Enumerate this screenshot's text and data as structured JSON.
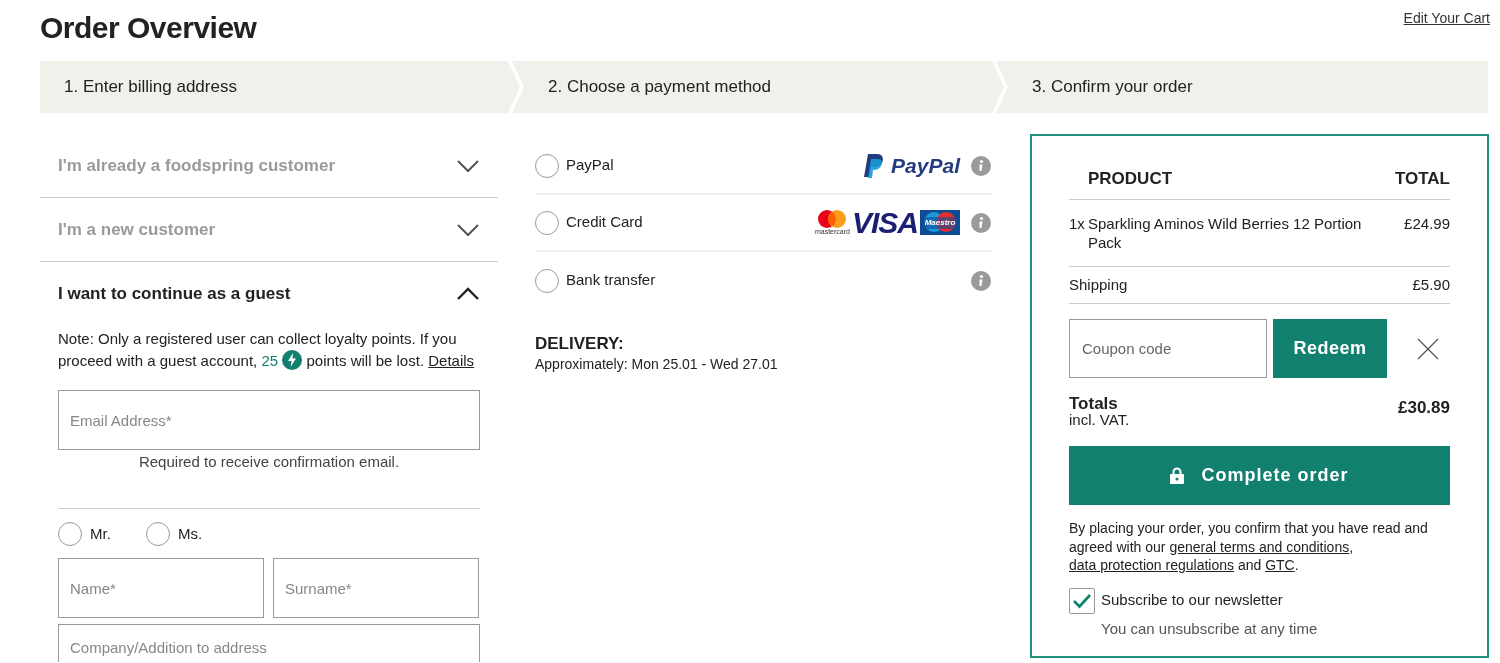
{
  "header": {
    "title": "Order Overview",
    "edit_link": "Edit Your Cart"
  },
  "steps": [
    {
      "label": "1. Enter billing address"
    },
    {
      "label": "2. Choose a payment method"
    },
    {
      "label": "3. Confirm your order"
    }
  ],
  "accordion": [
    {
      "title": "I'm already a foodspring customer",
      "expanded": false
    },
    {
      "title": "I'm a new customer",
      "expanded": false
    },
    {
      "title": "I want to continue as a guest",
      "expanded": true
    }
  ],
  "guest": {
    "note": {
      "before": "Note: Only a registered user can collect loyalty points. If you proceed with a guest account,",
      "points": "25",
      "after": "points will be lost.",
      "link": "Details"
    },
    "email": {
      "placeholder": "Email Address*",
      "hint": "Required to receive confirmation email."
    },
    "salutation": [
      {
        "label": "Mr.",
        "selected": false
      },
      {
        "label": "Ms.",
        "selected": false
      }
    ],
    "name": {
      "placeholder": "Name*"
    },
    "surname": {
      "placeholder": "Surname*"
    },
    "company": {
      "placeholder": "Company/Addition to address"
    }
  },
  "payment_methods": [
    {
      "label": "PayPal",
      "selected": false,
      "logos": [
        {
          "kind": "paypal",
          "text": "PayPal"
        }
      ]
    },
    {
      "label": "Credit Card",
      "selected": false,
      "logos": [
        {
          "kind": "mastercard",
          "text": "mastercard"
        },
        {
          "kind": "visa",
          "text": "VISA"
        },
        {
          "kind": "maestro",
          "text": "Maestro"
        }
      ]
    },
    {
      "label": "Bank transfer",
      "selected": false
    }
  ],
  "delivery": {
    "heading": "DELIVERY:",
    "text": "Approximately: Mon 25.01 - Wed 27.01"
  },
  "summary": {
    "columns": [
      "PRODUCT",
      "TOTAL"
    ],
    "items": [
      {
        "qty": "1x",
        "name": "Sparkling Aminos Wild Berries 12 Portion Pack",
        "price": "£24.99"
      }
    ],
    "shipping": {
      "label": "Shipping",
      "price": "£5.90"
    },
    "coupon": {
      "placeholder": "Coupon code",
      "button": "Redeem"
    },
    "totals": {
      "label": "Totals",
      "sub": "incl. VAT.",
      "price": "£30.89"
    },
    "complete_button": "Complete order",
    "terms": [
      {
        "text": "By placing your order, you confirm that you have read and agreed with our ",
        "link": false
      },
      {
        "text": "general terms and conditions",
        "link": true
      },
      {
        "text": ", ",
        "link": false
      },
      {
        "text": "data protection regulations",
        "link": true
      },
      {
        "text": " and ",
        "link": false
      },
      {
        "text": "GTC",
        "link": true
      },
      {
        "text": ".",
        "link": false
      }
    ],
    "newsletter": {
      "label": "Subscribe to our newsletter",
      "checked": true,
      "hint": "You can unsubscribe at any time"
    }
  }
}
